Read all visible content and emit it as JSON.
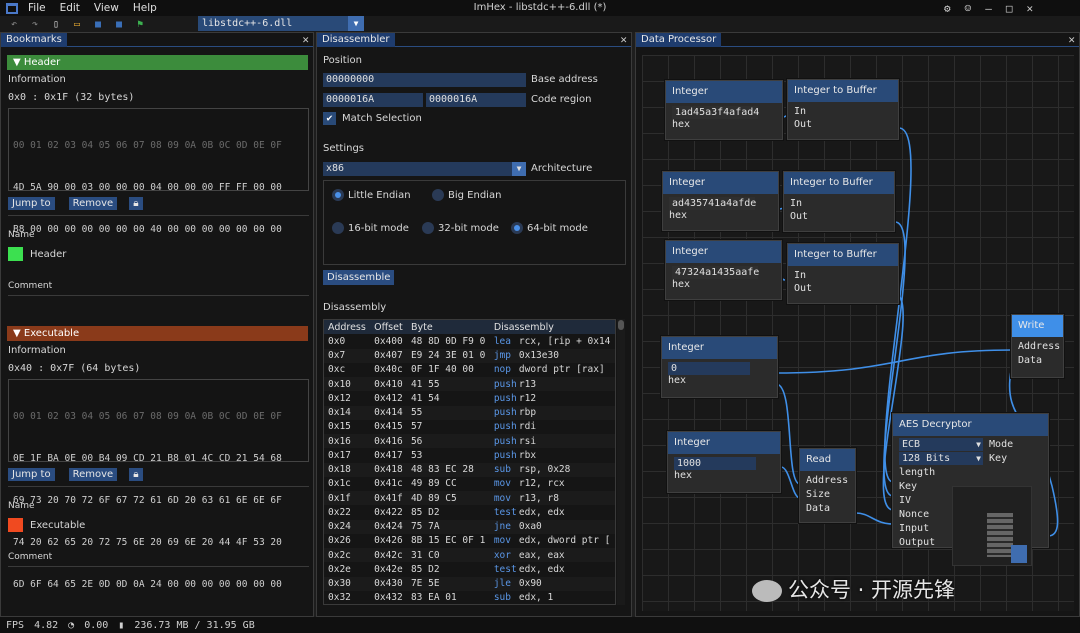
{
  "menu": {
    "file": "File",
    "edit": "Edit",
    "view": "View",
    "help": "Help"
  },
  "window_title": "ImHex - libstdc++-6.dll (*)",
  "window_controls": {
    "settings": "⚙",
    "smile": "☺",
    "minimize": "—",
    "maximize": "□",
    "close": "✕"
  },
  "file_combo": "libstdc++-6.dll",
  "bookmarks": {
    "tab": "Bookmarks",
    "close": "✕",
    "header": {
      "title": "▼  Header",
      "color": "#3c8c3c",
      "info_label": "Information",
      "range": "0x0 : 0x1F (32 bytes)",
      "hex_header": "00 01 02 03 04 05 06 07 08 09 0A 0B 0C 0D 0E 0F",
      "rows": [
        "4D 5A 90 00 03 00 00 00 04 00 00 00 FF FF 00 00",
        "B8 00 00 00 00 00 00 00 40 00 00 00 00 00 00 00"
      ],
      "jump": "Jump to",
      "remove": "Remove",
      "name_label": "Name",
      "name": "Header",
      "swatch": "#3ce050",
      "comment_label": "Comment"
    },
    "executable": {
      "title": "▼  Executable",
      "color": "#8a3a1a",
      "info_label": "Information",
      "range": "0x40 : 0x7F (64 bytes)",
      "hex_header": "00 01 02 03 04 05 06 07 08 09 0A 0B 0C 0D 0E 0F",
      "rows": [
        "0E 1F BA 0E 00 B4 09 CD 21 B8 01 4C CD 21 54 68",
        "69 73 20 70 72 6F 67 72 61 6D 20 63 61 6E 6E 6F",
        "74 20 62 65 20 72 75 6E 20 69 6E 20 44 4F 53 20",
        "6D 6F 64 65 2E 0D 0D 0A 24 00 00 00 00 00 00 00"
      ],
      "jump": "Jump to",
      "remove": "Remove",
      "name_label": "Name",
      "name": "Executable",
      "swatch": "#f04a20",
      "comment_label": "Comment"
    }
  },
  "disassembler": {
    "tab": "Disassembler",
    "close": "✕",
    "position_label": "Position",
    "base_address": "00000000",
    "base_address_label": "Base address",
    "region_start": "0000016A",
    "region_end": "0000016A",
    "code_region_label": "Code region",
    "match_selection": "Match Selection",
    "settings_label": "Settings",
    "architecture": "x86",
    "architecture_label": "Architecture",
    "little_endian": "Little Endian",
    "big_endian": "Big Endian",
    "mode16": "16-bit mode",
    "mode32": "32-bit mode",
    "mode64": "64-bit mode",
    "disassemble_btn": "Disassemble",
    "disassembly_label": "Disassembly",
    "columns": [
      "Address",
      "Offset",
      "Byte",
      "Disassembly"
    ],
    "rows": [
      [
        "0x0",
        "0x400",
        "48 8D 0D F9 0",
        "lea",
        "rcx, [rip + 0x14"
      ],
      [
        "0x7",
        "0x407",
        "E9 24 3E 01 0",
        "jmp",
        "0x13e30"
      ],
      [
        "0xc",
        "0x40c",
        "0F 1F 40 00",
        "nop",
        "dword ptr [rax]"
      ],
      [
        "0x10",
        "0x410",
        "41 55",
        "push",
        "r13"
      ],
      [
        "0x12",
        "0x412",
        "41 54",
        "push",
        "r12"
      ],
      [
        "0x14",
        "0x414",
        "55",
        "push",
        "rbp"
      ],
      [
        "0x15",
        "0x415",
        "57",
        "push",
        "rdi"
      ],
      [
        "0x16",
        "0x416",
        "56",
        "push",
        "rsi"
      ],
      [
        "0x17",
        "0x417",
        "53",
        "push",
        "rbx"
      ],
      [
        "0x18",
        "0x418",
        "48 83 EC 28",
        "sub",
        "rsp, 0x28"
      ],
      [
        "0x1c",
        "0x41c",
        "49 89 CC",
        "mov",
        "r12, rcx"
      ],
      [
        "0x1f",
        "0x41f",
        "4D 89 C5",
        "mov",
        "r13, r8"
      ],
      [
        "0x22",
        "0x422",
        "85 D2",
        "test",
        "edx, edx"
      ],
      [
        "0x24",
        "0x424",
        "75 7A",
        "jne",
        "0xa0"
      ],
      [
        "0x26",
        "0x426",
        "8B 15 EC 0F 1",
        "mov",
        "edx, dword ptr ["
      ],
      [
        "0x2c",
        "0x42c",
        "31 C0",
        "xor",
        "eax, eax"
      ],
      [
        "0x2e",
        "0x42e",
        "85 D2",
        "test",
        "edx, edx"
      ],
      [
        "0x30",
        "0x430",
        "7E 5E",
        "jle",
        "0x90"
      ],
      [
        "0x32",
        "0x432",
        "83 EA 01",
        "sub",
        "edx, 1"
      ]
    ]
  },
  "data_processor": {
    "tab": "Data Processor",
    "close": "✕",
    "nodes": {
      "int1": {
        "title": "Integer",
        "value": "1ad45a3f4afad4",
        "unit": "hex"
      },
      "int2": {
        "title": "Integer",
        "value": "ad435741a4afde",
        "unit": "hex"
      },
      "int3": {
        "title": "Integer",
        "value": "47324a1435aafe",
        "unit": "hex"
      },
      "int4": {
        "title": "Integer",
        "value": "0",
        "unit": "hex"
      },
      "int5": {
        "title": "Integer",
        "value": "1000",
        "unit": "hex"
      },
      "buf1": {
        "title": "Integer to Buffer",
        "in": "In",
        "out": "Out"
      },
      "buf2": {
        "title": "Integer to Buffer",
        "in": "In",
        "out": "Out"
      },
      "buf3": {
        "title": "Integer to Buffer",
        "in": "In",
        "out": "Out"
      },
      "write": {
        "title": "Write",
        "address": "Address",
        "data": "Data"
      },
      "read": {
        "title": "Read",
        "address": "Address",
        "size": "Size",
        "data": "Data"
      },
      "aes": {
        "title": "AES Decryptor",
        "mode_value": "ECB",
        "mode_label": "Mode",
        "keylen_value": "128 Bits",
        "keylen_label": "Key length",
        "key": "Key",
        "iv": "IV",
        "nonce": "Nonce",
        "input": "Input",
        "output": "Output"
      }
    }
  },
  "watermark": "公众号 · 开源先锋",
  "status": {
    "fps_label": "FPS",
    "fps": "4.82",
    "cpu": "0.00",
    "mem": "236.73 MB / 31.95 GB"
  }
}
